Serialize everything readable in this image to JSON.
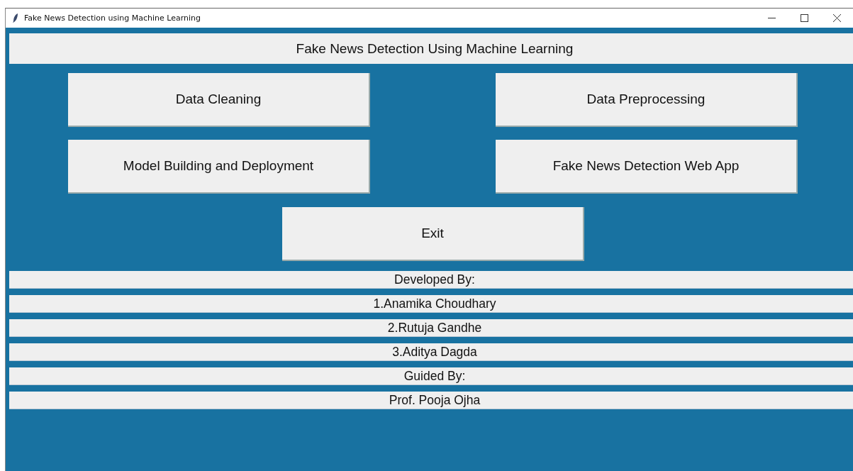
{
  "window": {
    "title": "Fake News Detection using Machine Learning"
  },
  "header": "Fake News Detection Using Machine Learning",
  "buttons": [
    {
      "label": "Data Cleaning"
    },
    {
      "label": "Data Preprocessing"
    },
    {
      "label": "Model Building and Deployment"
    },
    {
      "label": "Fake News Detection Web App"
    }
  ],
  "exit_button": "Exit",
  "credits": [
    "Developed By:",
    "1.Anamika Choudhary",
    "2.Rutuja Gandhe",
    "3.Aditya Dagda",
    "Guided By:",
    "Prof. Pooja Ojha"
  ]
}
